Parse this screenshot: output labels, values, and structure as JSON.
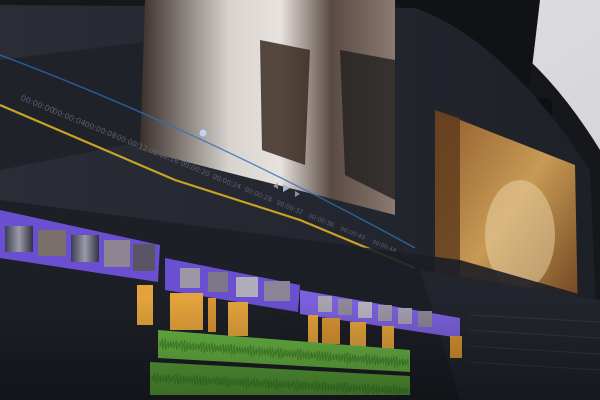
{
  "scene": {
    "subject": "video editing timeline on a curved monitor",
    "colors": {
      "wall": "#dcdcde",
      "monitor_bezel": "#15171b",
      "ui_bg": "#23262e",
      "ui_panel": "#1b1d23",
      "timeline_bg": "#202229",
      "ruler_text": "#5c6270",
      "video_track": "#6a4fd1",
      "video_track_light": "#8b74ea",
      "audio_clip": "#e2a23c",
      "audio_clip_dark": "#b8781f",
      "waveform_track": "#67b443",
      "waveform_dark": "#3e7f27",
      "ruler_line_gold": "#c9a227",
      "ruler_line_blue": "#2f6fb5",
      "playhead": "#bcd3ff"
    }
  },
  "viewer": {
    "transport_icons": [
      "prev-frame-icon",
      "play-icon",
      "next-frame-icon"
    ]
  },
  "timeline": {
    "ruler_labels": [
      "00:00:00",
      "00:00:04",
      "00:00:08",
      "00:00:12",
      "00:00:16",
      "00:00:20",
      "00:00:24",
      "00:00:28",
      "00:00:32",
      "00:00:36",
      "00:00:40",
      "00:00:44",
      "00:00:48"
    ]
  }
}
